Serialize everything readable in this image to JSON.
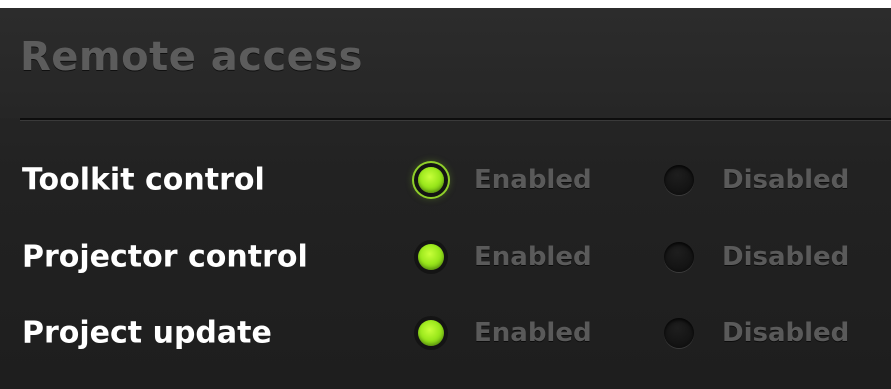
{
  "panel": {
    "title": "Remote access"
  },
  "settings": [
    {
      "label": "Toolkit control",
      "enabled_label": "Enabled",
      "disabled_label": "Disabled",
      "selected": "enabled"
    },
    {
      "label": "Projector control",
      "enabled_label": "Enabled",
      "disabled_label": "Disabled",
      "selected": "enabled"
    },
    {
      "label": "Project update",
      "enabled_label": "Enabled",
      "disabled_label": "Disabled",
      "selected": "enabled"
    }
  ],
  "colors": {
    "accent": "#9be81c",
    "background": "#242424",
    "title": "#5c5c5c",
    "label": "#ffffff",
    "option_text": "#5a5a5a"
  }
}
